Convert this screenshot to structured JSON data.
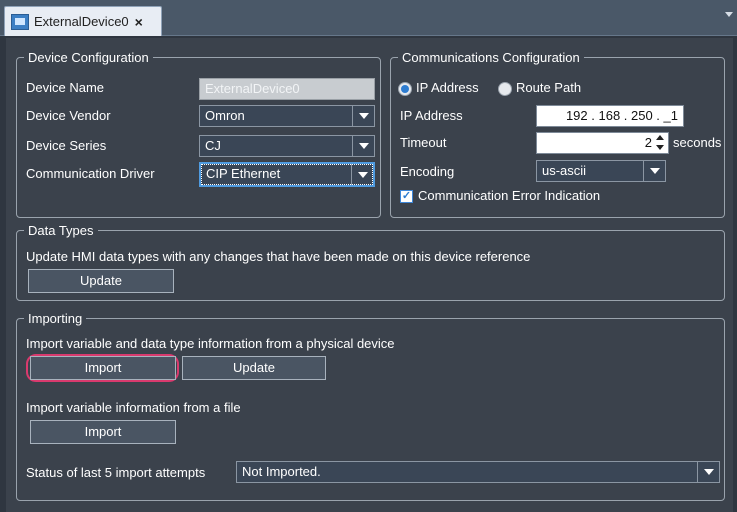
{
  "tab": {
    "title": "ExternalDevice0",
    "close": "×"
  },
  "device_config": {
    "legend": "Device Configuration",
    "device_name_label": "Device Name",
    "device_name_value": "ExternalDevice0",
    "vendor_label": "Device Vendor",
    "vendor_value": "Omron",
    "series_label": "Device Series",
    "series_value": "CJ",
    "driver_label": "Communication Driver",
    "driver_value": "CIP Ethernet"
  },
  "comm_config": {
    "legend": "Communications Configuration",
    "ip_radio_label": "IP Address",
    "route_radio_label": "Route Path",
    "ip_label": "IP Address",
    "ip_value": "192 . 168 . 250 . _1",
    "timeout_label": "Timeout",
    "timeout_value": "2",
    "timeout_unit": "seconds",
    "encoding_label": "Encoding",
    "encoding_value": "us-ascii",
    "error_indication_label": "Communication Error Indication"
  },
  "data_types": {
    "legend": "Data Types",
    "description": "Update HMI data types with any changes that have been made on this device reference",
    "update_button": "Update"
  },
  "importing": {
    "legend": "Importing",
    "physical_description": "Import variable and data type information from a physical device",
    "import_button": "Import",
    "update_button": "Update",
    "file_description": "Import variable information from a file",
    "file_import_button": "Import",
    "status_label": "Status of last 5 import attempts",
    "status_value": "Not Imported."
  },
  "colors": {
    "background": "#3b424c",
    "highlight_ring": "#d93a6e",
    "accent": "#2d7cd0"
  }
}
